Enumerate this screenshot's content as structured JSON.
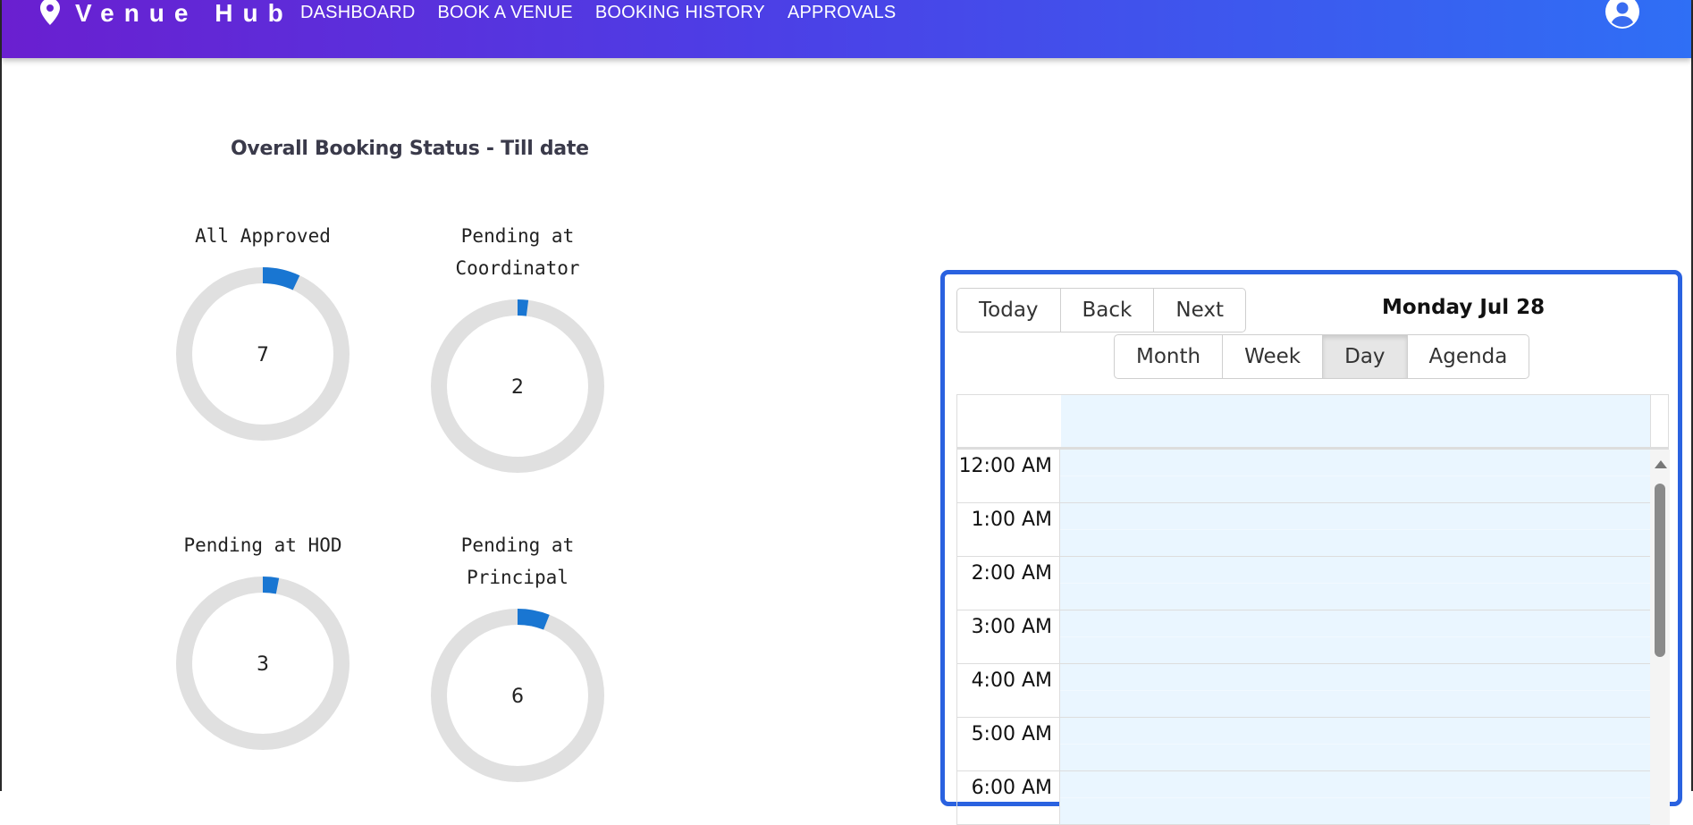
{
  "app": {
    "name": "Venue Hub"
  },
  "nav": {
    "items": [
      {
        "label": "DASHBOARD"
      },
      {
        "label": "BOOK A VENUE"
      },
      {
        "label": "BOOKING HISTORY"
      },
      {
        "label": "APPROVALS"
      }
    ]
  },
  "colors": {
    "accent": "#1976d2",
    "track": "#e0e0e0",
    "calendar_border": "#2a62e0",
    "slot_bg": "#eaf6ff"
  },
  "status": {
    "title": "Overall Booking Status - Till date",
    "donuts": [
      {
        "label_lines": [
          "All Approved"
        ],
        "value": 7,
        "max": 100
      },
      {
        "label_lines": [
          "Pending at",
          "Coordinator"
        ],
        "value": 2,
        "max": 100
      },
      {
        "label_lines": [
          "Pending at HOD"
        ],
        "value": 3,
        "max": 100
      },
      {
        "label_lines": [
          "Pending at",
          "Principal"
        ],
        "value": 6,
        "max": 100
      }
    ]
  },
  "calendar": {
    "nav_buttons": [
      "Today",
      "Back",
      "Next"
    ],
    "date_label": "Monday Jul 28",
    "views": [
      "Month",
      "Week",
      "Day",
      "Agenda"
    ],
    "active_view": "Day",
    "times": [
      "12:00 AM",
      "1:00 AM",
      "2:00 AM",
      "3:00 AM",
      "4:00 AM",
      "5:00 AM",
      "6:00 AM"
    ]
  }
}
